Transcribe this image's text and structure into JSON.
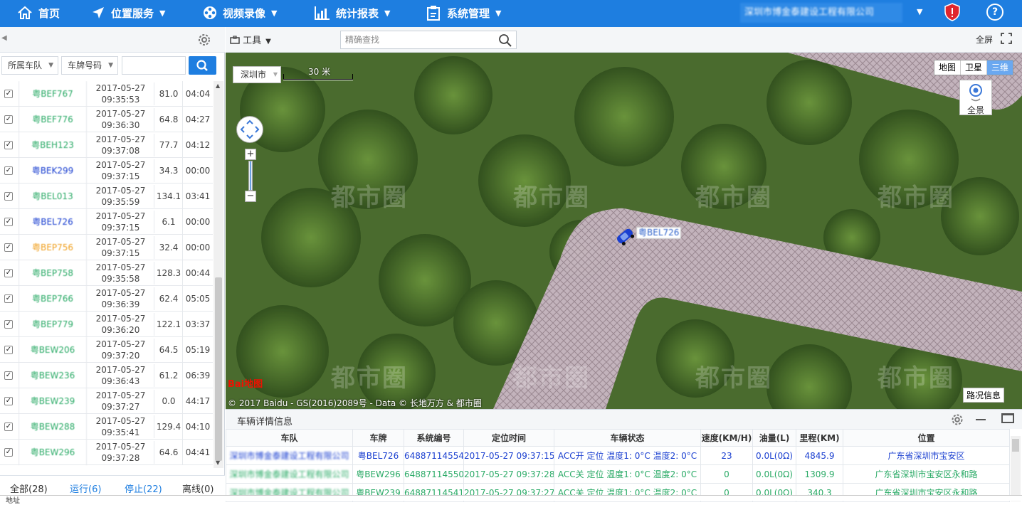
{
  "nav": {
    "home": "首页",
    "location": "位置服务",
    "video": "视频录像",
    "reports": "统计报表",
    "system": "系统管理",
    "company": "深圳市博金泰建设工程有限公司"
  },
  "left": {
    "filter_team": "所属车队",
    "filter_plate": "车牌号码",
    "vehicles": [
      {
        "plate": "粤BEF767",
        "date": "2017-05-27",
        "time": "09:35:53",
        "speed": "81.0",
        "duration": "04:04",
        "color": "#2aaa66"
      },
      {
        "plate": "粤BEF776",
        "date": "2017-05-27",
        "time": "09:36:30",
        "speed": "64.8",
        "duration": "04:27",
        "color": "#2aaa66"
      },
      {
        "plate": "粤BEH123",
        "date": "2017-05-27",
        "time": "09:37:08",
        "speed": "77.7",
        "duration": "04:12",
        "color": "#2aaa66"
      },
      {
        "plate": "粤BEK299",
        "date": "2017-05-27",
        "time": "09:37:15",
        "speed": "34.3",
        "duration": "00:00",
        "color": "#1a3fd0"
      },
      {
        "plate": "粤BEL013",
        "date": "2017-05-27",
        "time": "09:35:59",
        "speed": "134.1",
        "duration": "03:41",
        "color": "#2aaa66"
      },
      {
        "plate": "粤BEL726",
        "date": "2017-05-27",
        "time": "09:37:15",
        "speed": "6.1",
        "duration": "00:00",
        "color": "#1a3fd0"
      },
      {
        "plate": "粤BEP756",
        "date": "2017-05-27",
        "time": "09:37:15",
        "speed": "32.4",
        "duration": "00:00",
        "color": "#f0a020"
      },
      {
        "plate": "粤BEP758",
        "date": "2017-05-27",
        "time": "09:35:58",
        "speed": "128.3",
        "duration": "00:44",
        "color": "#2aaa66"
      },
      {
        "plate": "粤BEP766",
        "date": "2017-05-27",
        "time": "09:36:39",
        "speed": "62.4",
        "duration": "05:05",
        "color": "#2aaa66"
      },
      {
        "plate": "粤BEP779",
        "date": "2017-05-27",
        "time": "09:36:20",
        "speed": "122.1",
        "duration": "03:37",
        "color": "#2aaa66"
      },
      {
        "plate": "粤BEW206",
        "date": "2017-05-27",
        "time": "09:37:20",
        "speed": "64.5",
        "duration": "05:19",
        "color": "#2aaa66"
      },
      {
        "plate": "粤BEW236",
        "date": "2017-05-27",
        "time": "09:36:43",
        "speed": "61.2",
        "duration": "06:39",
        "color": "#2aaa66"
      },
      {
        "plate": "粤BEW239",
        "date": "2017-05-27",
        "time": "09:37:27",
        "speed": "0.0",
        "duration": "44:17",
        "color": "#2aaa66"
      },
      {
        "plate": "粤BEW288",
        "date": "2017-05-27",
        "time": "09:35:41",
        "speed": "129.4",
        "duration": "04:10",
        "color": "#2aaa66"
      },
      {
        "plate": "粤BEW296",
        "date": "2017-05-27",
        "time": "09:37:28",
        "speed": "64.6",
        "duration": "04:41",
        "color": "#2aaa66"
      }
    ],
    "tabs": {
      "all": "全部(28)",
      "running": "运行(6)",
      "stopped": "停止(22)",
      "offline": "离线(0)"
    }
  },
  "map": {
    "tool": "工具",
    "search_placeholder": "精确查找",
    "fullscreen": "全屏",
    "city": "深圳市",
    "scale": "30 米",
    "types": [
      "地图",
      "卫星",
      "三维"
    ],
    "panorama": "全景",
    "car_label": "粤BEL726",
    "baidu_logo": "Bai地图",
    "copyright": "© 2017 Baidu - GS(2016)2089号 - Data © 长地万方 & 都市圈",
    "traffic": "路况信息",
    "watermark": "都市圈"
  },
  "detail": {
    "title": "车辆详情信息",
    "headers": [
      "车队",
      "车牌",
      "系统编号",
      "定位时间",
      "车辆状态",
      "速度(KM/H)",
      "油量(L)",
      "里程(KM)",
      "位置"
    ],
    "rows": [
      [
        "深圳市博金泰建设工程有限公司",
        "粤BEL726",
        "64887114554",
        "2017-05-27 09:37:15",
        "ACC开 定位 温度1: 0°C 温度2: 0°C",
        "23",
        "0.0L(0Ω)",
        "4845.9",
        "广东省深圳市宝安区"
      ],
      [
        "深圳市博金泰建设工程有限公司",
        "粤BEW296",
        "64887114550",
        "2017-05-27 09:37:28",
        "ACC关 定位 温度1: 0°C 温度2: 0°C",
        "0",
        "0.0L(0Ω)",
        "1309.9",
        "广东省深圳市宝安区永和路"
      ],
      [
        "深圳市博金泰建设工程有限公司",
        "粤BEW239",
        "64887114541",
        "2017-05-27 09:37:27",
        "ACC关 定位 温度1: 0°C 温度2: 0°C",
        "0",
        "0.0L(0Ω)",
        "340.3",
        "广东省深圳市宝安区永和路"
      ]
    ]
  },
  "bottom": {
    "label": "地址"
  }
}
